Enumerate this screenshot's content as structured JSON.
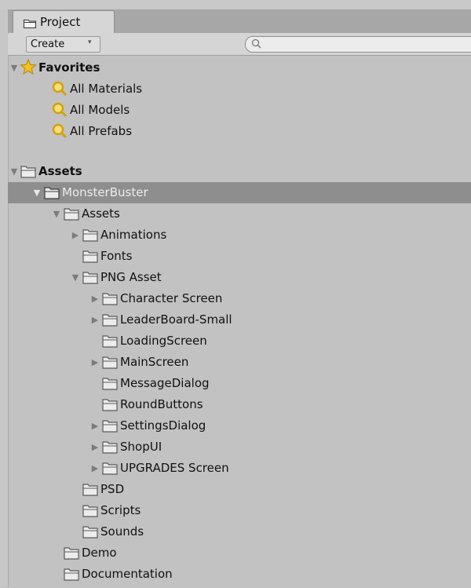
{
  "project_tab": {
    "label": "Project",
    "icon": "folder-icon"
  },
  "toolbar": {
    "create_label": "Create",
    "create_caret": "▾",
    "search_value": ""
  },
  "colors": {
    "selected_row": "#8e8e8e",
    "panel_bg": "#c2c2c2",
    "folder": "#ececec",
    "star": "#f2c21d"
  },
  "tree": {
    "favorites": {
      "label": "Favorites",
      "expanded": true,
      "icon": "star-icon"
    },
    "fav_items": [
      {
        "label": "All Materials",
        "icon": "search-icon"
      },
      {
        "label": "All Models",
        "icon": "search-icon"
      },
      {
        "label": "All Prefabs",
        "icon": "search-icon"
      }
    ],
    "assets_root": {
      "label": "Assets",
      "expanded": true
    },
    "items": [
      {
        "label": "MonsterBuster",
        "depth": 1,
        "arrow": "expanded",
        "selected": true
      },
      {
        "label": "Assets",
        "depth": 2,
        "arrow": "expanded"
      },
      {
        "label": "Animations",
        "depth": 3,
        "arrow": "collapsed"
      },
      {
        "label": "Fonts",
        "depth": 3,
        "arrow": "none"
      },
      {
        "label": "PNG Asset",
        "depth": 3,
        "arrow": "expanded"
      },
      {
        "label": "Character Screen",
        "depth": 4,
        "arrow": "collapsed"
      },
      {
        "label": "LeaderBoard-Small",
        "depth": 4,
        "arrow": "collapsed"
      },
      {
        "label": "LoadingScreen",
        "depth": 4,
        "arrow": "none"
      },
      {
        "label": "MainScreen",
        "depth": 4,
        "arrow": "collapsed"
      },
      {
        "label": "MessageDialog",
        "depth": 4,
        "arrow": "none"
      },
      {
        "label": "RoundButtons",
        "depth": 4,
        "arrow": "none"
      },
      {
        "label": "SettingsDialog",
        "depth": 4,
        "arrow": "collapsed"
      },
      {
        "label": "ShopUI",
        "depth": 4,
        "arrow": "collapsed"
      },
      {
        "label": "UPGRADES Screen",
        "depth": 4,
        "arrow": "collapsed"
      },
      {
        "label": "PSD",
        "depth": 3,
        "arrow": "none"
      },
      {
        "label": "Scripts",
        "depth": 3,
        "arrow": "none"
      },
      {
        "label": "Sounds",
        "depth": 3,
        "arrow": "none"
      },
      {
        "label": "Demo",
        "depth": 2,
        "arrow": "none"
      },
      {
        "label": "Documentation",
        "depth": 2,
        "arrow": "none"
      }
    ]
  }
}
